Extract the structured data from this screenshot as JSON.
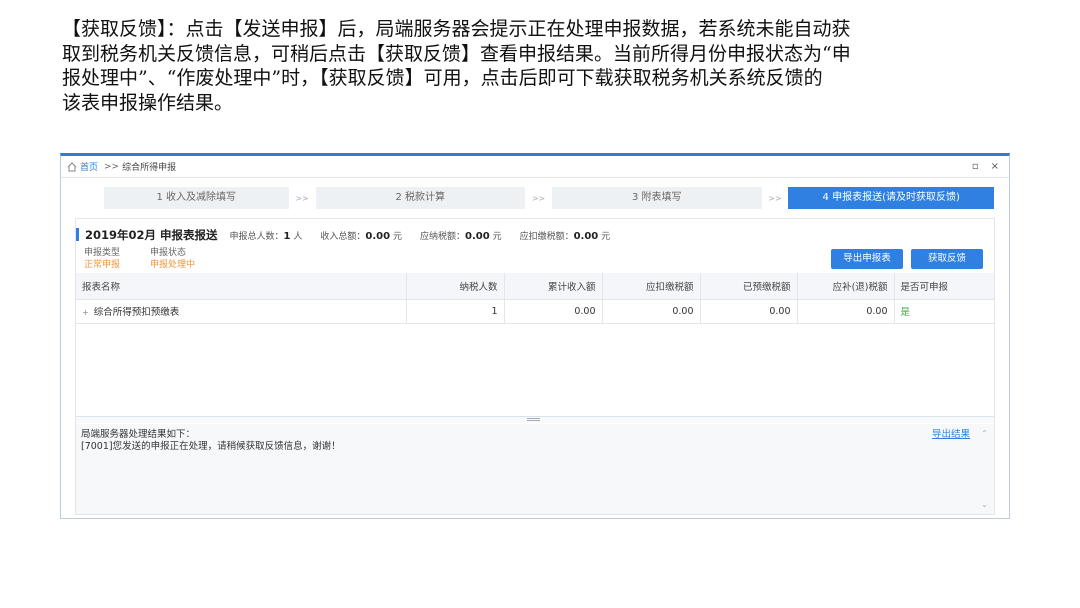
{
  "intro": {
    "line1": "【获取反馈】：点击【发送申报】后，局端服务器会提示正在处理申报数据，若系统未能自动获",
    "line2": "取到税务机关反馈信息，可稍后点击【获取反馈】查看申报结果。当前所得月份申报状态为“申",
    "line3": "报处理中”、“作废处理中”时，【获取反馈】可用，点击后即可下载获取税务机关系统反馈的",
    "line4": "该表申报操作结果。"
  },
  "window": {
    "breadcrumb_home": "首页",
    "breadcrumb_sep": ">>",
    "breadcrumb_current": "综合所得申报",
    "home_icon": "home-icon",
    "restore_icon": "restore-icon",
    "close_icon": "close-icon",
    "restore_glyph": "▫",
    "close_glyph": "×"
  },
  "steps": [
    {
      "label": "1 收入及减除填写",
      "active": false
    },
    {
      "label": "2 税款计算",
      "active": false
    },
    {
      "label": "3 附表填写",
      "active": false
    },
    {
      "label": "4 申报表报送(请及时获取反馈)",
      "active": true
    }
  ],
  "step_arrow": ">>",
  "summary": {
    "title": "2019年02月  申报表报送",
    "people_label": "申报总人数：",
    "people_value": "1",
    "people_unit": "人",
    "income_label": "收入总额：",
    "income_value": "0.00",
    "income_unit": "元",
    "tax_payable_label": "应纳税额：",
    "tax_payable_value": "0.00",
    "tax_payable_unit": "元",
    "withheld_label": "应扣缴税额：",
    "withheld_value": "0.00",
    "withheld_unit": "元"
  },
  "meta": {
    "type_label": "申报类型",
    "type_value": "正常申报",
    "status_label": "申报状态",
    "status_value": "申报处理中"
  },
  "buttons": {
    "export_report": "导出申报表",
    "get_feedback": "获取反馈"
  },
  "table": {
    "columns": [
      "报表名称",
      "纳税人数",
      "累计收入额",
      "应扣缴税额",
      "已预缴税额",
      "应补(退)税额",
      "是否可申报"
    ],
    "rows": [
      {
        "name": "综合所得预扣预缴表",
        "taxpayers": "1",
        "income": "0.00",
        "withheld": "0.00",
        "prepaid": "0.00",
        "refund": "0.00",
        "can_file": "是"
      }
    ]
  },
  "result": {
    "heading": "局端服务器处理结果如下：",
    "message": "[7001]您发送的申报正在处理，请稍候获取反馈信息，谢谢！",
    "export_link": "导出结果"
  },
  "colors": {
    "accent": "#2f80e0",
    "status_orange": "#f0963c",
    "yes_green": "#3cb043"
  }
}
